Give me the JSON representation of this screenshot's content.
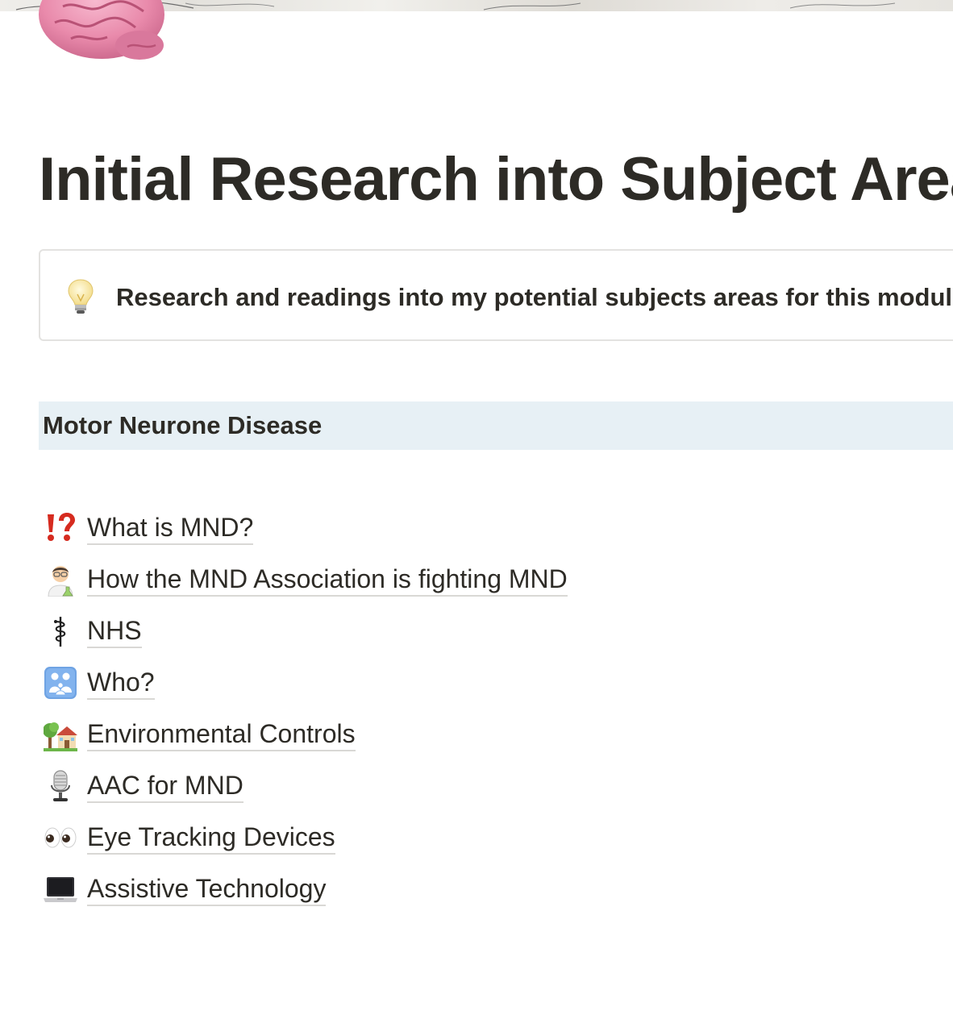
{
  "page": {
    "icon": "brain-icon",
    "title": "Initial Research into Subject Areas"
  },
  "callout": {
    "icon": "light-bulb-icon",
    "text": "Research and readings into my potential subjects areas for this module"
  },
  "section": {
    "heading": "Motor Neurone Disease",
    "background_color": "#e7f0f5"
  },
  "links": [
    {
      "icon": "exclamation-question-mark-icon",
      "label": "What is MND?"
    },
    {
      "icon": "scientist-icon",
      "label": "How the MND Association is fighting MND"
    },
    {
      "icon": "medical-symbol-icon",
      "label": "NHS"
    },
    {
      "icon": "family-icon",
      "label": "Who?"
    },
    {
      "icon": "house-with-garden-icon",
      "label": "Environmental Controls"
    },
    {
      "icon": "microphone-icon",
      "label": "AAC for MND"
    },
    {
      "icon": "eyes-icon",
      "label": "Eye Tracking Devices"
    },
    {
      "icon": "laptop-icon",
      "label": "Assistive Technology"
    }
  ],
  "colors": {
    "text": "#2d2b26",
    "callout_border": "#e3e2e0",
    "link_underline": "#d9d8d5"
  }
}
